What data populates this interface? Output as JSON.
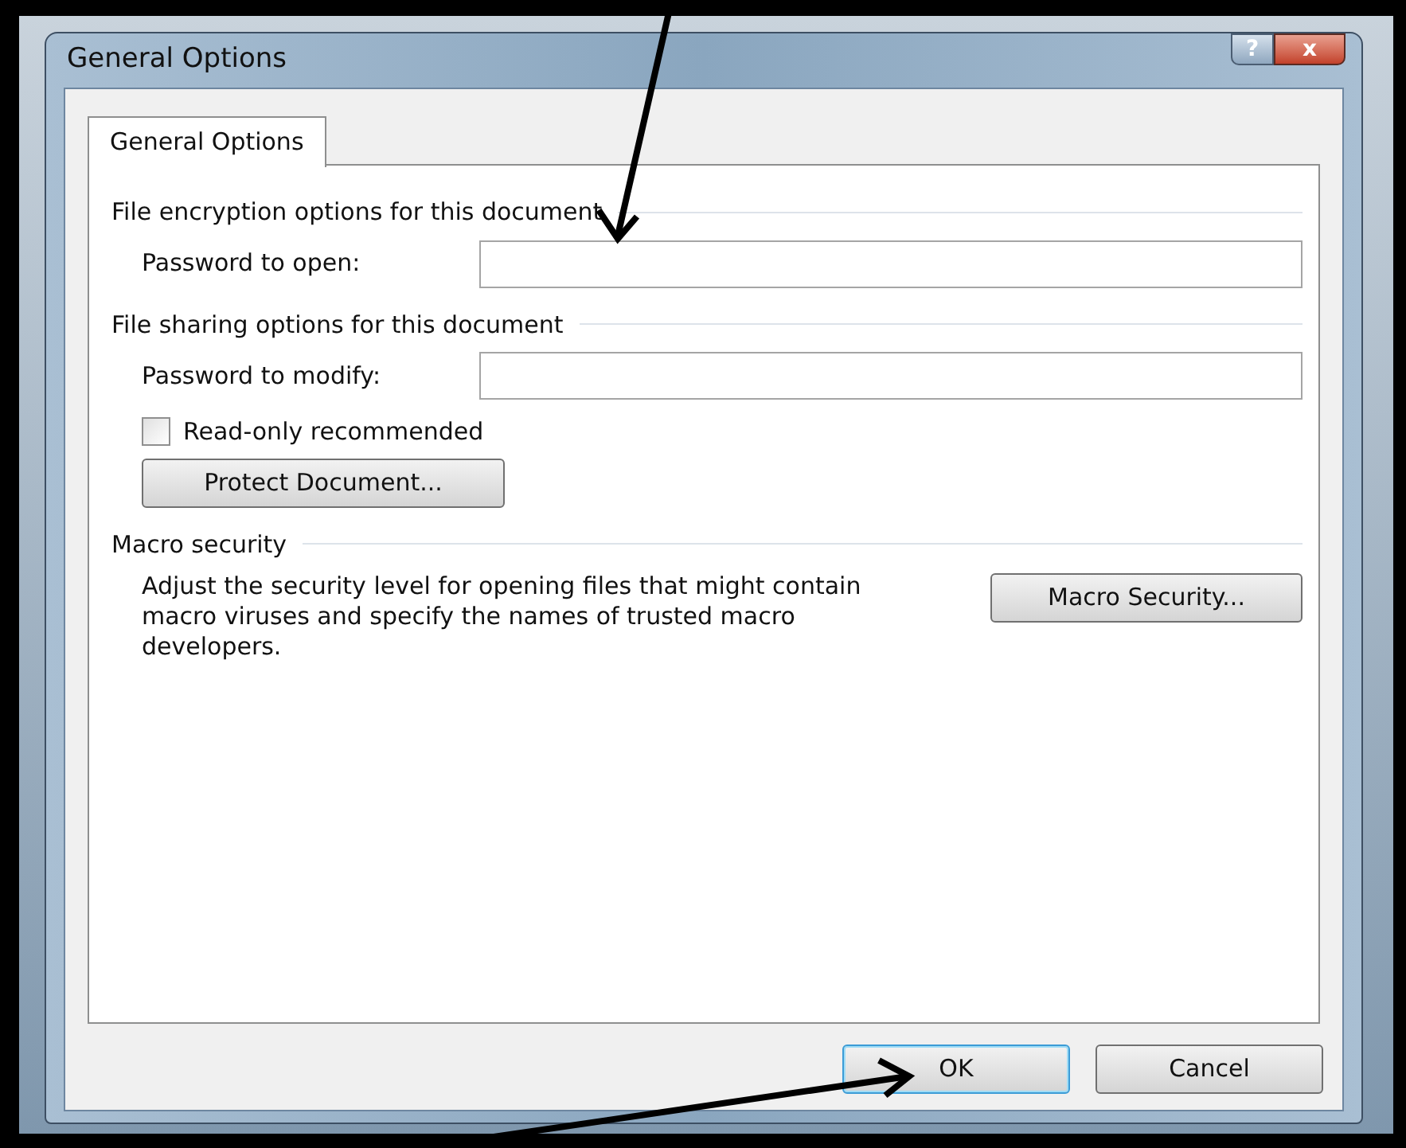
{
  "window": {
    "title": "General Options"
  },
  "title_buttons": [
    {
      "kind": "help",
      "label": "?"
    },
    {
      "kind": "close",
      "label": "x"
    }
  ],
  "tabs": [
    {
      "label": "General Options",
      "selected": true
    }
  ],
  "sections": [
    {
      "heading": "File encryption options for this document",
      "items": [
        {
          "kind": "field",
          "label": "Password to open:",
          "value": ""
        }
      ]
    },
    {
      "heading": "File sharing options for this document",
      "items": [
        {
          "kind": "field",
          "label": "Password to modify:",
          "value": ""
        },
        {
          "kind": "checkbox",
          "label": "Read-only recommended",
          "checked": false
        },
        {
          "kind": "button",
          "label": "Protect Document..."
        }
      ]
    },
    {
      "heading": "Macro security",
      "items": [
        {
          "kind": "text_button",
          "text": "Adjust the security level for opening files that might contain macro viruses and specify the names of trusted macro developers.",
          "button": "Macro Security..."
        }
      ]
    }
  ],
  "buttons": [
    {
      "label": "OK",
      "default": true
    },
    {
      "label": "Cancel",
      "default": false
    }
  ]
}
